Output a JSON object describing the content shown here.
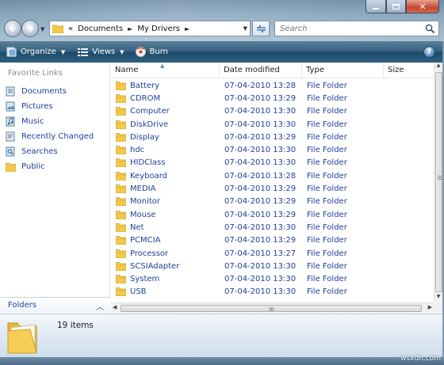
{
  "address_bar": {
    "overflow_glyph": "«",
    "crumbs": [
      "Documents",
      "My Drivers"
    ]
  },
  "search": {
    "placeholder": "Search"
  },
  "toolbar": {
    "organize": "Organize",
    "views": "Views",
    "burn": "Burn",
    "help": "?"
  },
  "nav_pane": {
    "title": "Favorite Links",
    "links": [
      "Documents",
      "Pictures",
      "Music",
      "Recently Changed",
      "Searches",
      "Public"
    ],
    "folders_label": "Folders"
  },
  "columns": [
    "Name",
    "Date modified",
    "Type",
    "Size"
  ],
  "files": [
    {
      "name": "Battery",
      "date": "07-04-2010 13:28",
      "type": "File Folder"
    },
    {
      "name": "CDROM",
      "date": "07-04-2010 13:29",
      "type": "File Folder"
    },
    {
      "name": "Computer",
      "date": "07-04-2010 13:30",
      "type": "File Folder"
    },
    {
      "name": "DiskDrive",
      "date": "07-04-2010 13:30",
      "type": "File Folder"
    },
    {
      "name": "Display",
      "date": "07-04-2010 13:29",
      "type": "File Folder"
    },
    {
      "name": "hdc",
      "date": "07-04-2010 13:30",
      "type": "File Folder"
    },
    {
      "name": "HIDClass",
      "date": "07-04-2010 13:30",
      "type": "File Folder"
    },
    {
      "name": "Keyboard",
      "date": "07-04-2010 13:28",
      "type": "File Folder"
    },
    {
      "name": "MEDIA",
      "date": "07-04-2010 13:29",
      "type": "File Folder"
    },
    {
      "name": "Monitor",
      "date": "07-04-2010 13:29",
      "type": "File Folder"
    },
    {
      "name": "Mouse",
      "date": "07-04-2010 13:29",
      "type": "File Folder"
    },
    {
      "name": "Net",
      "date": "07-04-2010 13:30",
      "type": "File Folder"
    },
    {
      "name": "PCMCIA",
      "date": "07-04-2010 13:29",
      "type": "File Folder"
    },
    {
      "name": "Processor",
      "date": "07-04-2010 13:27",
      "type": "File Folder"
    },
    {
      "name": "SCSIAdapter",
      "date": "07-04-2010 13:30",
      "type": "File Folder"
    },
    {
      "name": "System",
      "date": "07-04-2010 13:30",
      "type": "File Folder"
    },
    {
      "name": "USB",
      "date": "07-04-2010 13:30",
      "type": "File Folder"
    }
  ],
  "details": {
    "item_count": "19 items"
  },
  "watermark": "wsxdn.com",
  "colors": {
    "link_blue": "#1e3f9c",
    "toolbar_dark": "#1d4a6a",
    "folder_yellow": "#f2c94c"
  },
  "icons": {
    "folder": "folder-icon",
    "back": "back-arrow-icon",
    "forward": "forward-arrow-icon",
    "refresh": "refresh-icon",
    "search": "search-icon",
    "organize": "organize-icon",
    "views": "views-icon",
    "burn": "burn-disc-icon",
    "help": "help-icon"
  }
}
